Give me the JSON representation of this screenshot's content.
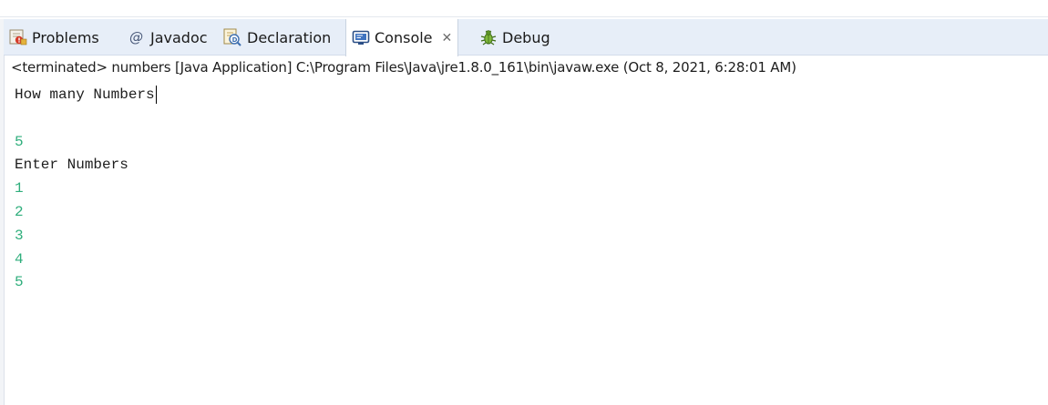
{
  "tabs": [
    {
      "label": "Problems",
      "icon": "problems-icon",
      "active": false
    },
    {
      "label": "Javadoc",
      "icon": "at-sign-icon",
      "active": false
    },
    {
      "label": "Declaration",
      "icon": "declaration-icon",
      "active": false
    },
    {
      "label": "Console",
      "icon": "console-icon",
      "active": true,
      "close": "✕"
    },
    {
      "label": "Debug",
      "icon": "bug-icon",
      "active": false
    }
  ],
  "console": {
    "status": "<terminated> numbers [Java Application] C:\\Program Files\\Java\\jre1.8.0_161\\bin\\javaw.exe (Oct 8, 2021, 6:28:01 AM)",
    "lines": [
      {
        "text": "How many Numbers",
        "kind": "output"
      },
      {
        "text": "",
        "kind": "output"
      },
      {
        "text": "5",
        "kind": "input"
      },
      {
        "text": "Enter Numbers",
        "kind": "output"
      },
      {
        "text": "1",
        "kind": "input"
      },
      {
        "text": "2",
        "kind": "input"
      },
      {
        "text": "3",
        "kind": "input"
      },
      {
        "text": "4",
        "kind": "input"
      },
      {
        "text": "5",
        "kind": "input"
      }
    ]
  },
  "colors": {
    "user_input": "#2fae7c",
    "program_output": "#1e1e1e",
    "tab_bar": "#e7eef8"
  }
}
